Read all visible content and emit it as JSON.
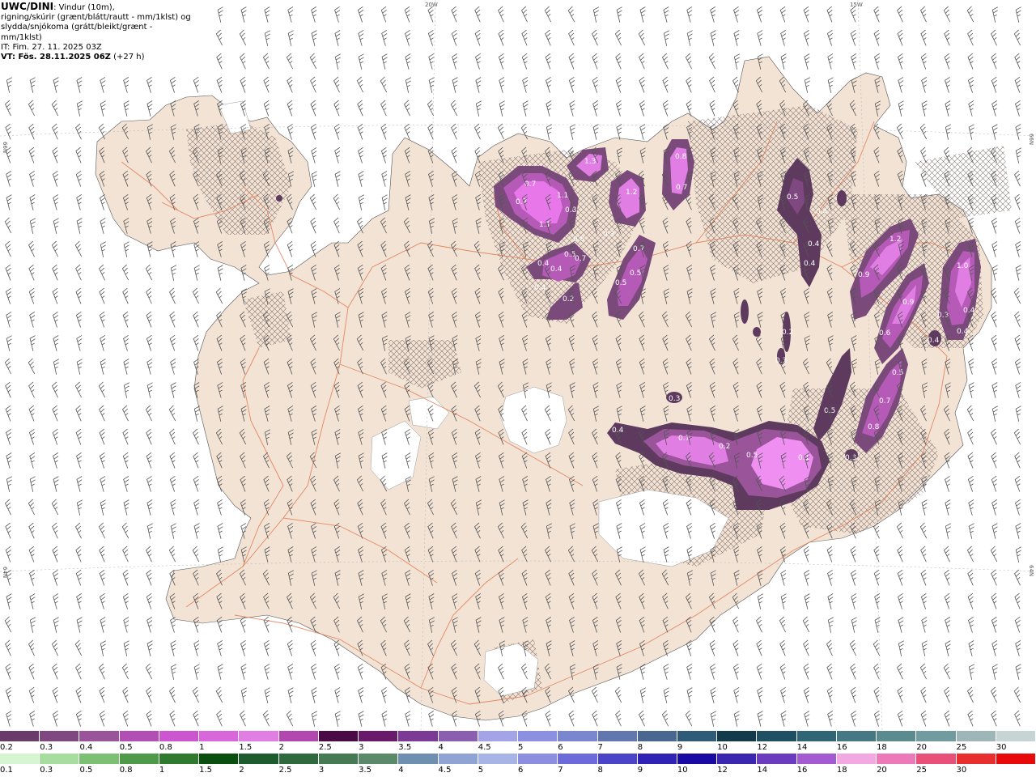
{
  "header": {
    "model": "UWC/DINI",
    "desc_line1": ": Vindur (10m),",
    "desc_line2": "rigning/skúrir (grænt/blátt/rautt - mm/1klst) og",
    "desc_line3": "slydda/snjókoma (grátt/bleikt/grænt - mm/1klst)",
    "it": "IT: Fim. 27. 11. 2025 03Z",
    "vt": "VT: Fös. 28.11.2025 06Z",
    "lead": "(+27 h)"
  },
  "grid_labels": {
    "lon_20w": "20W",
    "lon_15w": "15W",
    "lat_66n_left": "66N",
    "lat_66n_right": "66N",
    "lat_64n_left": "64N",
    "lat_64n_right": "64N"
  },
  "precip_labels": [
    {
      "id": "p1",
      "text": "0.7"
    },
    {
      "id": "p2",
      "text": "0.7"
    },
    {
      "id": "p3",
      "text": "1.1"
    },
    {
      "id": "p4",
      "text": "1.1"
    },
    {
      "id": "p5",
      "text": "0.8"
    },
    {
      "id": "p6",
      "text": "1.3"
    },
    {
      "id": "p7",
      "text": "1.2"
    },
    {
      "id": "p8",
      "text": "0.8"
    },
    {
      "id": "p9",
      "text": "0.7"
    },
    {
      "id": "p10",
      "text": "0.5"
    },
    {
      "id": "p11",
      "text": "0.4"
    },
    {
      "id": "p12",
      "text": "0.4"
    },
    {
      "id": "p13",
      "text": "0.7"
    },
    {
      "id": "p14",
      "text": "0.8"
    },
    {
      "id": "p15",
      "text": "0.4"
    },
    {
      "id": "p16",
      "text": "0.3"
    },
    {
      "id": "p17",
      "text": "0.2"
    },
    {
      "id": "p18",
      "text": "0.7"
    },
    {
      "id": "p19",
      "text": "0.5"
    },
    {
      "id": "p20",
      "text": "0.5"
    },
    {
      "id": "p21",
      "text": "0.5"
    },
    {
      "id": "p22",
      "text": "0.4"
    },
    {
      "id": "p23",
      "text": "0.4"
    },
    {
      "id": "p24",
      "text": "0.4"
    },
    {
      "id": "p25",
      "text": "1.2"
    },
    {
      "id": "p26",
      "text": "0.9"
    },
    {
      "id": "p27",
      "text": "1.0"
    },
    {
      "id": "p28",
      "text": "0.9"
    },
    {
      "id": "p29",
      "text": "0.3"
    },
    {
      "id": "p30",
      "text": "0.4"
    },
    {
      "id": "p31",
      "text": "0.4"
    },
    {
      "id": "p32",
      "text": "0.6"
    },
    {
      "id": "p33",
      "text": "0.4"
    },
    {
      "id": "p34",
      "text": "0.2"
    },
    {
      "id": "p35",
      "text": "0.3"
    },
    {
      "id": "p36",
      "text": "0.5"
    },
    {
      "id": "p37",
      "text": "0.7"
    },
    {
      "id": "p38",
      "text": "0.5"
    },
    {
      "id": "p39",
      "text": "0.8"
    },
    {
      "id": "p40",
      "text": "0.3"
    },
    {
      "id": "p41",
      "text": "0.4"
    },
    {
      "id": "p42",
      "text": "0.7"
    },
    {
      "id": "p43",
      "text": "0.2"
    },
    {
      "id": "p44",
      "text": "0.5"
    },
    {
      "id": "p45",
      "text": "0.1"
    },
    {
      "id": "p46",
      "text": "0.3"
    }
  ],
  "scale_top": {
    "ticks": [
      "0.2",
      "0.3",
      "0.4",
      "0.5",
      "0.8",
      "1",
      "1.5",
      "2",
      "2.5",
      "3",
      "3.5",
      "4",
      "4.5",
      "5",
      "6",
      "7",
      "8",
      "9",
      "10",
      "12",
      "14",
      "16",
      "18",
      "20",
      "25",
      "30"
    ],
    "colors": [
      "#6a3b6a",
      "#7f4880",
      "#9a549a",
      "#b14fb5",
      "#cc55d0",
      "#d967dc",
      "#e07ee3",
      "#b347b0",
      "#4a0a45",
      "#6a1a6a",
      "#7a3a95",
      "#8a5fb0",
      "#a3a3e8",
      "#8d8fe0",
      "#7b86d0",
      "#6277b0",
      "#4a6790",
      "#2f5a78",
      "#123a4a",
      "#1f4f62",
      "#2f6575",
      "#457882",
      "#5b8a8f",
      "#729b9f",
      "#9fb6b8",
      "#c7d4d4"
    ]
  },
  "scale_bottom": {
    "ticks": [
      "0.1",
      "0.3",
      "0.5",
      "0.8",
      "1",
      "1.5",
      "2",
      "2.5",
      "3",
      "3.5",
      "4",
      "4.5",
      "5",
      "6",
      "7",
      "8",
      "9",
      "10",
      "12",
      "14",
      "16",
      "18",
      "20",
      "25",
      "30"
    ],
    "colors": [
      "#d7f5d0",
      "#a8dda0",
      "#7cc173",
      "#4f9a48",
      "#2f7a2f",
      "#0b4f0e",
      "#1d5c2c",
      "#2f6a3f",
      "#457a55",
      "#5b8a6b",
      "#6e8fb0",
      "#8fa3d4",
      "#a7b4e6",
      "#8c8fe0",
      "#6d6ad9",
      "#4b44c8",
      "#2f22b4",
      "#1a0aa3",
      "#3b26b0",
      "#6b3bc0",
      "#a45ad0",
      "#f2a8e0",
      "#ec7ab8",
      "#e8507a",
      "#e82f2f",
      "#e80a0a"
    ]
  }
}
